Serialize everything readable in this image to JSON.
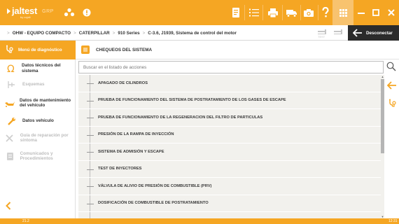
{
  "app": {
    "logo_text": "jaltest",
    "logo_sub": "by cojali",
    "logo_suffix": "GRP"
  },
  "toolbar": {
    "icons": [
      "group-icon",
      "alert-icon",
      "report-icon",
      "list-icon",
      "print-icon",
      "truck-icon",
      "camera-icon",
      "help-icon",
      "apps-grid-icon",
      "minimize-icon",
      "maximize-icon",
      "close-icon"
    ]
  },
  "breadcrumb": {
    "items": [
      "OHW - EQUIPO COMPACTO",
      "CATERPILLAR",
      "910 Series",
      "C-3.6, J1939, Sistema de control del motor"
    ]
  },
  "disconnect": {
    "label": "Desconectar"
  },
  "sidebar": {
    "header": "Menú de diagnóstico",
    "items": [
      {
        "label": "Datos técnicos del sistema",
        "state": "active"
      },
      {
        "label": "Esquemas",
        "state": "disabled"
      },
      {
        "label": "Datos de mantenimiento del vehículo",
        "state": "active"
      },
      {
        "label": "Datos vehículo",
        "state": "active"
      },
      {
        "label": "Guía de reparación por síntoma",
        "state": "disabled"
      },
      {
        "label": "Comunicados y Procedimientos",
        "state": "disabled"
      }
    ]
  },
  "main": {
    "title": "CHEQUEOS DEL SISTEMA",
    "search_placeholder": "Buscar en el listado de acciones",
    "rows": [
      "APAGADO DE CILINDROS",
      "PRUEBA DE FUNCIONAMIENTO DEL SISTEMA DE POSTRATAMIENTO DE LOS GASES DE ESCAPE",
      "PRUEBA DE FUNCIONAMIENTO DE LA REGENERACION DEL FILTRO DE PARTICULAS",
      "PRESIÓN DE LA RAMPA DE INYECCIÓN",
      "SISTEMA DE ADMISIÓN Y ESCAPE",
      "TEST DE INYECTORES",
      "VÁLVULA DE ALIVIO DE PRESIÓN DE COMBUSTIBLE (PRV)",
      "DOSIFICACIÓN DE COMBUSTIBLE DE POSTRATAMIENTO"
    ],
    "scroll_fraction": 0.45
  },
  "statusbar": {
    "version": "21.2",
    "time": "12:31"
  },
  "colors": {
    "brand": "#f5a623",
    "dark": "#2b2b2b",
    "list_bg": "#f2f1ed"
  }
}
